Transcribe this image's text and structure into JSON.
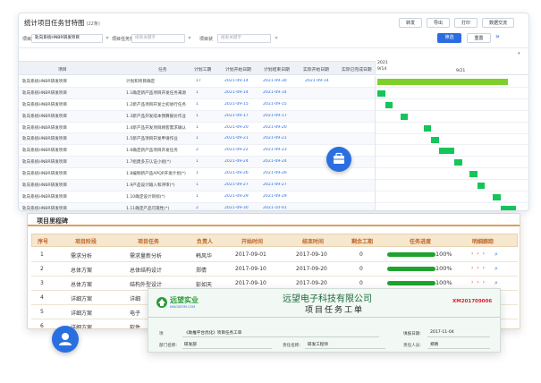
{
  "gantt": {
    "title": "统计项目任务甘特图",
    "count": "(22条)",
    "buttons": [
      "转发",
      "导出",
      "打印",
      "数据交流"
    ],
    "filters": {
      "project_label": "项目",
      "project_value": "轨向系统HNBR研发项目",
      "type_label": "项目任务类",
      "type_placeholder": "搜索关键字",
      "status_label": "项目状",
      "status_placeholder": "搜索关键字"
    },
    "search_label": "筛选",
    "reset_label": "重置",
    "expand_icon": "»",
    "columns": [
      "项目",
      "任务",
      "计划工期",
      "计划开始日期",
      "计划结束日期",
      "实际开始日期",
      "实际已完成日期"
    ],
    "timeline": {
      "year": "2021",
      "date_a": "9/14",
      "date_b": "9/21"
    },
    "rows": [
      {
        "project": "轨向系统HNBR研发项目",
        "task": "计划和项目确定",
        "days": "17",
        "plan_start": "2021-09-14",
        "plan_end": "2021-09-30",
        "actual_start": "2021-09-14"
      },
      {
        "project": "轨向系统HNBR研发项目",
        "task": "1.1确定新产品项目开发任务来源",
        "days": "1",
        "plan_start": "2021-09-14",
        "plan_end": "2021-09-14",
        "actual_start": ""
      },
      {
        "project": "轨向系统HNBR研发项目",
        "task": "1.2新产品项目开发之初进行任务",
        "days": "1",
        "plan_start": "2021-09-15",
        "plan_end": "2021-09-15",
        "actual_start": ""
      },
      {
        "project": "轨向系统HNBR研发项目",
        "task": "1.3新产品开发成本预算报价作业",
        "days": "1",
        "plan_start": "2021-09-17",
        "plan_end": "2021-09-17",
        "actual_start": ""
      },
      {
        "project": "轨向系统HNBR研发项目",
        "task": "1.4新产品开发项目顾客需求确认",
        "days": "1",
        "plan_start": "2021-09-20",
        "plan_end": "2021-09-20",
        "actual_start": ""
      },
      {
        "project": "轨向系统HNBR研发项目",
        "task": "1.5新产品项目开发申请作业",
        "days": "1",
        "plan_start": "2021-09-21",
        "plan_end": "2021-09-21",
        "actual_start": ""
      },
      {
        "project": "轨向系统HNBR研发项目",
        "task": "1.6确定新产品项目开发任务",
        "days": "2",
        "plan_start": "2021-09-22",
        "plan_end": "2021-09-23",
        "actual_start": ""
      },
      {
        "project": "轨向系统HNBR研发项目",
        "task": "1.7组建多方认证小组(*)",
        "days": "1",
        "plan_start": "2021-09-24",
        "plan_end": "2021-09-24",
        "actual_start": ""
      },
      {
        "project": "轨向系统HNBR研发项目",
        "task": "1.8编制新产品APQP开发计划(*)",
        "days": "1",
        "plan_start": "2021-09-26",
        "plan_end": "2021-09-26",
        "actual_start": ""
      },
      {
        "project": "轨向系统HNBR研发项目",
        "task": "1.9产品设计输入和评审(*)",
        "days": "1",
        "plan_start": "2021-09-27",
        "plan_end": "2021-09-27",
        "actual_start": ""
      },
      {
        "project": "轨向系统HNBR研发项目",
        "task": "1.10确定设计目标(*)",
        "days": "1",
        "plan_start": "2021-09-29",
        "plan_end": "2021-09-29",
        "actual_start": ""
      },
      {
        "project": "轨向系统HNBR研发项目",
        "task": "1.11确定产品可靠性(*)",
        "days": "2",
        "plan_start": "2021-09-30",
        "plan_end": "2021-10-01",
        "actual_start": ""
      }
    ],
    "chart_data": {
      "type": "gantt",
      "start_day": 0,
      "bars": [
        [
          0,
          17
        ],
        [
          0,
          1
        ],
        [
          1,
          1
        ],
        [
          3,
          1
        ],
        [
          6,
          1
        ],
        [
          7,
          1
        ],
        [
          8,
          2
        ],
        [
          10,
          1
        ],
        [
          12,
          1
        ],
        [
          13,
          1
        ],
        [
          15,
          1
        ],
        [
          16,
          2
        ]
      ]
    }
  },
  "milestones": {
    "title": "项目里程碑",
    "columns": [
      "序号",
      "项目阶段",
      "项目任务",
      "负责人",
      "开始时间",
      "结束时间",
      "剩余工期",
      "任务进度",
      "明细跟踪"
    ],
    "rows": [
      {
        "no": "1",
        "stage": "需求分析",
        "task": "需求量新分析",
        "owner": "韩风华",
        "start": "2017-09-01",
        "end": "2017-09-10",
        "remain": "0",
        "progress_label": "100%",
        "progress": 1.0
      },
      {
        "no": "2",
        "stage": "总体方案",
        "task": "总体结构设计",
        "owner": "郑倩",
        "start": "2017-09-10",
        "end": "2017-09-20",
        "remain": "0",
        "progress_label": "100%",
        "progress": 1.0
      },
      {
        "no": "3",
        "stage": "总体方案",
        "task": "结构外型设计",
        "owner": "彭如天",
        "start": "2017-09-10",
        "end": "2017-09-20",
        "remain": "0",
        "progress_label": "100%",
        "progress": 1.0
      },
      {
        "no": "4",
        "stage": "详细方案",
        "task": "详细",
        "owner": "",
        "start": "",
        "end": "",
        "remain": "",
        "progress_label": "",
        "progress": 0
      },
      {
        "no": "5",
        "stage": "详细方案",
        "task": "电子",
        "owner": "",
        "start": "",
        "end": "",
        "remain": "",
        "progress_label": "",
        "progress": 0
      },
      {
        "no": "6",
        "stage": "详细方案",
        "task": "软件",
        "owner": "",
        "start": "",
        "end": "",
        "remain": "",
        "progress_label": "",
        "progress": 0
      }
    ],
    "arrows": "› › ›"
  },
  "work_order": {
    "logo_cn": "远望实业",
    "logo_en": "KINGSEEM.COM",
    "company": "远望电子科技有限公司",
    "code": "XM201709006",
    "title": "项目任务工单",
    "fields": {
      "item_label": "项",
      "item_value": "《助推平台优化》项目任务工单",
      "date_label": "填报日期:",
      "date_value": "2017-11-04",
      "dept_label": "部门名称:",
      "dept_value": "研发部",
      "role_label": "责任名称:",
      "role_value": "研发工程师",
      "person_label": "责任人员:",
      "person_value": "郑倩"
    }
  },
  "colors": {
    "accent": "#2b6de1",
    "gantt_bar": "#16c45a",
    "progress": "#1fa32e",
    "milestone_header_text": "#c0662a",
    "code_red": "#d9232c"
  }
}
